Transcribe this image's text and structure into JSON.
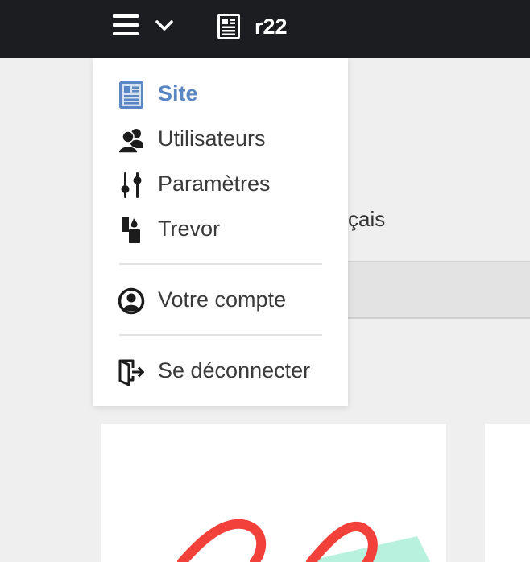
{
  "header": {
    "site_name": "r22",
    "menu_icon": "hamburger-icon",
    "expand_icon": "chevron-down-icon",
    "site_icon": "newspaper-icon"
  },
  "dropdown": {
    "items": [
      {
        "label": "Site",
        "icon": "newspaper-icon",
        "active": true
      },
      {
        "label": "Utilisateurs",
        "icon": "users-icon"
      },
      {
        "label": "Paramètres",
        "icon": "sliders-icon"
      },
      {
        "label": "Trevor",
        "icon": "lighter-icon"
      },
      {
        "label": "Votre compte",
        "icon": "user-circle-icon"
      },
      {
        "label": "Se déconnecter",
        "icon": "sign-out-icon"
      }
    ]
  },
  "background": {
    "partial_text": "çais"
  },
  "colors": {
    "topbar": "#1c1d21",
    "accent": "#5b86c4",
    "page_bg": "#efefef",
    "scribble_red": "#f2403a",
    "scribble_mint": "#b8f2df"
  }
}
